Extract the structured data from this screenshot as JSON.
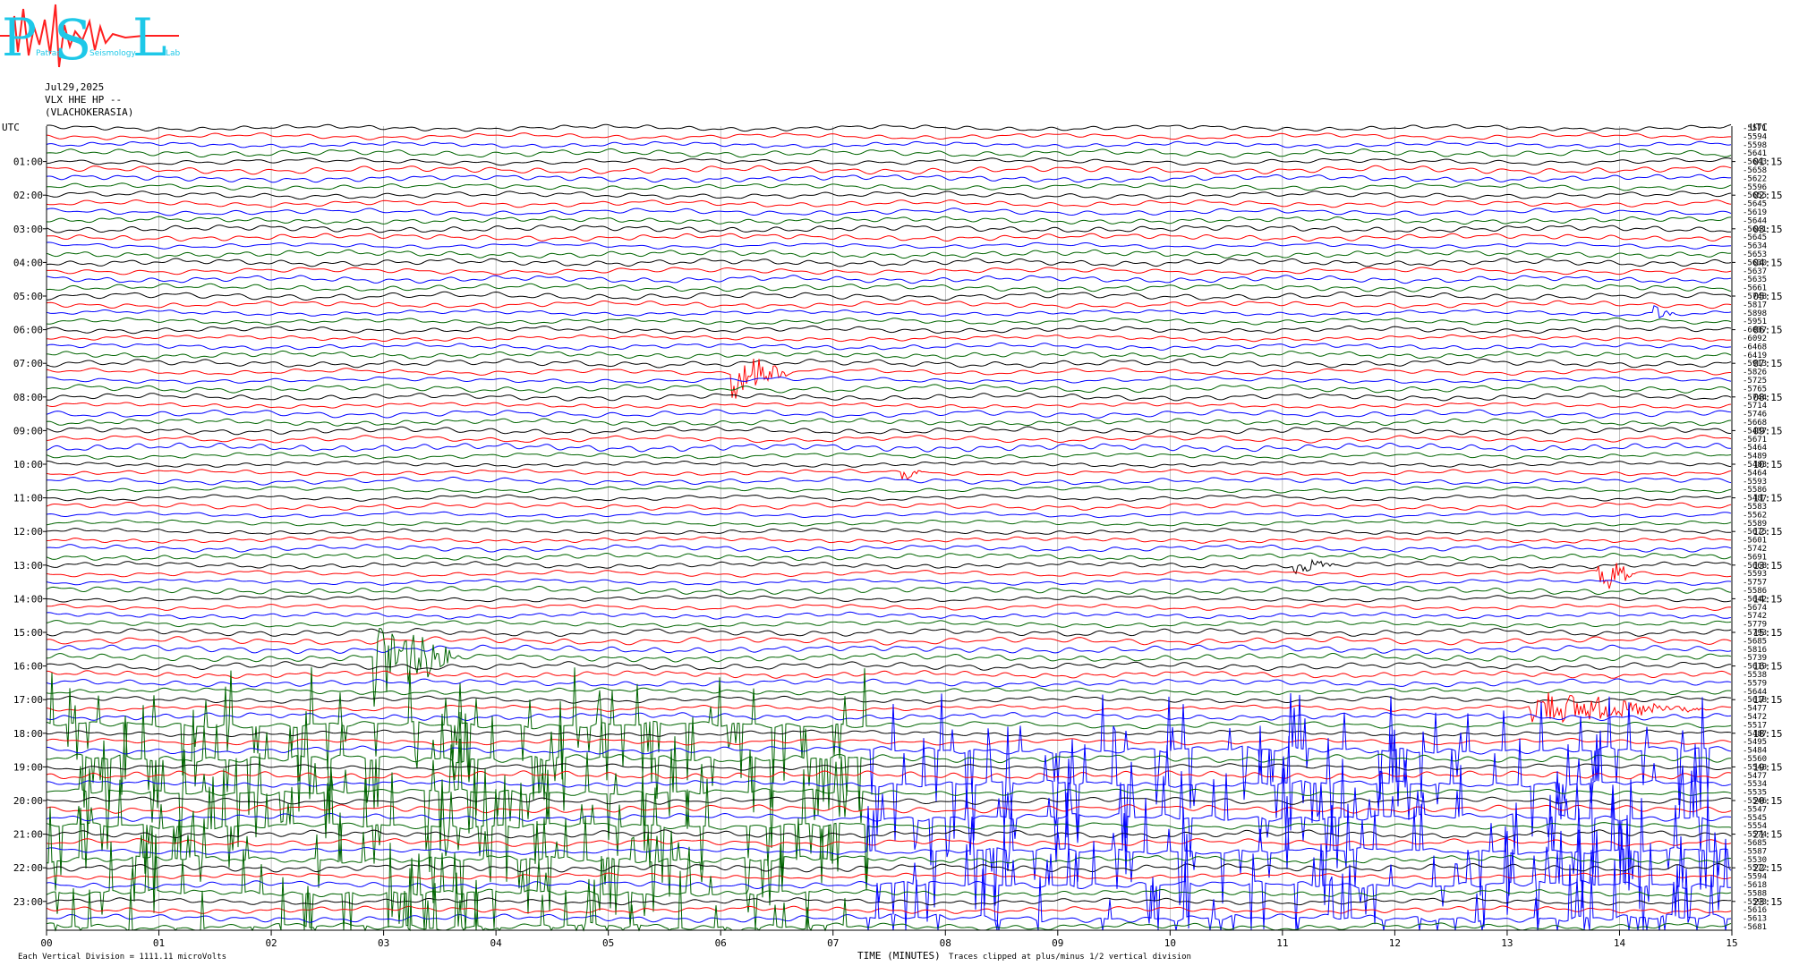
{
  "logo": {
    "letters": [
      "P",
      "S",
      "L"
    ],
    "text_lines": [
      "Patras",
      "Seismology",
      "Lab"
    ],
    "colors": {
      "letters": "#1ec8e8",
      "seismo": "#ff2020"
    }
  },
  "header": {
    "date": "Jul29,2025",
    "channel": "VLX HHE HP --",
    "station": "(VLACHOKERASIA)"
  },
  "footer": {
    "scale_note": "Each Vertical Division = 1111.11 microVolts",
    "time_label": "TIME (MINUTES)",
    "filter_note": "Traces clipped at plus/minus 1/2 vertical division"
  },
  "chart_data": {
    "type": "line",
    "title": "",
    "xlabel": "TIME (MINUTES)",
    "x_ticks": [
      "00",
      "01",
      "02",
      "03",
      "04",
      "05",
      "06",
      "07",
      "08",
      "09",
      "10",
      "11",
      "12",
      "13",
      "14",
      "15"
    ],
    "xlim": [
      0,
      15
    ],
    "left_axis_label": "UTC",
    "right_axis_label": "UTC",
    "left_hours": [
      "01:00",
      "02:00",
      "03:00",
      "04:00",
      "05:00",
      "06:00",
      "07:00",
      "08:00",
      "09:00",
      "10:00",
      "11:00",
      "12:00",
      "13:00",
      "14:00",
      "15:00",
      "16:00",
      "17:00",
      "18:00",
      "19:00",
      "20:00",
      "21:00",
      "22:00",
      "23:00"
    ],
    "right_hours": [
      "01:15",
      "02:15",
      "03:15",
      "04:15",
      "05:15",
      "06:15",
      "07:15",
      "08:15",
      "09:15",
      "10:15",
      "11:15",
      "12:15",
      "13:15",
      "14:15",
      "15:15",
      "16:15",
      "17:15",
      "18:15",
      "19:15",
      "20:15",
      "21:15",
      "22:15",
      "23:15"
    ],
    "trace_count": 96,
    "trace_colors": [
      "#000000",
      "#ff0000",
      "#0000ff",
      "#006400"
    ],
    "trace_offsets": [
      "-5571",
      "-5594",
      "-5598",
      "-5641",
      "-5643",
      "-5658",
      "-5622",
      "-5596",
      "-5655",
      "-5645",
      "-5619",
      "-5644",
      "-5641",
      "-5645",
      "-5634",
      "-5653",
      "-5630",
      "-5637",
      "-5635",
      "-5661",
      "-5748",
      "-5817",
      "-5898",
      "-5951",
      "-6037",
      "-6092",
      "-6468",
      "-6419",
      "-5913",
      "-5826",
      "-5725",
      "-5765",
      "-5744",
      "-5714",
      "-5746",
      "-5668",
      "-5437",
      "-5671",
      "-5464",
      "-5489",
      "-5483",
      "-5464",
      "-5593",
      "-5586",
      "-5487",
      "-5583",
      "-5562",
      "-5589",
      "-5675",
      "-5601",
      "-5742",
      "-5691",
      "-5668",
      "-5593",
      "-5757",
      "-5586",
      "-5642",
      "-5674",
      "-5742",
      "-5779",
      "-5793",
      "-5685",
      "-5816",
      "-5739",
      "-5619",
      "-5538",
      "-5579",
      "-5644",
      "-5618",
      "-5477",
      "-5472",
      "-5517",
      "-5487",
      "-5495",
      "-5484",
      "-5560",
      "-5548",
      "-5477",
      "-5534",
      "-5535",
      "-5546",
      "-5547",
      "-5545",
      "-5554",
      "-5574",
      "-5685",
      "-5587",
      "-5530",
      "-5572",
      "-5594",
      "-5618",
      "-5588",
      "-5593",
      "-5616",
      "-5613",
      "-5681"
    ],
    "events": [
      {
        "trace": 29,
        "minute": 6.1,
        "amplitude": 3.0,
        "duration_min": 0.55,
        "color_index": 0
      },
      {
        "trace": 63,
        "minute": 2.9,
        "amplitude": 6.0,
        "duration_min": 0.8,
        "color_index": 2
      },
      {
        "trace": 53,
        "minute": 13.8,
        "amplitude": 3.0,
        "duration_min": 0.35,
        "color_index": 0
      },
      {
        "trace": 69,
        "minute": 13.2,
        "amplitude": 2.2,
        "duration_min": 1.6,
        "color_index": 0
      },
      {
        "trace": 22,
        "minute": 14.3,
        "amplitude": 1.2,
        "duration_min": 0.2,
        "color_index": 0
      },
      {
        "trace": 41,
        "minute": 7.6,
        "amplitude": 1.0,
        "duration_min": 0.2,
        "color_index": 0
      },
      {
        "trace": 52,
        "minute": 11.1,
        "amplitude": 1.0,
        "duration_min": 0.4,
        "color_index": 3
      }
    ],
    "clipped_bursts": [
      {
        "color_index": 3,
        "from_trace": 70,
        "minute_start": 0.0,
        "minute_end": 7.3
      },
      {
        "color_index": 2,
        "from_trace": 72,
        "minute_start": 7.3,
        "minute_end": 15.0
      }
    ],
    "grid": true,
    "vertical_gridlines": "per minute"
  }
}
